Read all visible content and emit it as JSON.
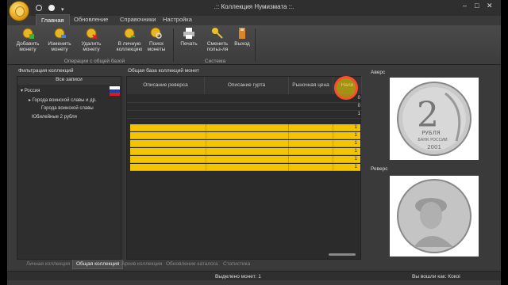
{
  "window": {
    "title": ".:: Коллекция Нумизмата ::."
  },
  "ribbon_tabs": [
    {
      "label": "Главная",
      "active": true
    },
    {
      "label": "Обновление",
      "active": false
    },
    {
      "label": "Справочники",
      "active": false
    },
    {
      "label": "Настройка",
      "active": false
    }
  ],
  "ribbon": {
    "buttons": [
      {
        "label": "Добавить монету",
        "icon": "add-coin-icon"
      },
      {
        "label": "Изменить монету",
        "icon": "edit-coin-icon"
      },
      {
        "label": "Удалить монету",
        "icon": "delete-coin-icon"
      },
      {
        "label": "В личную коллекцию",
        "icon": "personal-collection-icon"
      },
      {
        "label": "Поиск монеты",
        "icon": "search-coin-icon"
      },
      {
        "label": "Печать",
        "icon": "printer-icon"
      },
      {
        "label": "Сменить польз-ля",
        "icon": "key-icon"
      },
      {
        "label": "Выход",
        "icon": "exit-icon"
      }
    ],
    "groups": [
      "Операции с общей базой",
      "Система"
    ]
  },
  "filter_pane": {
    "header": "Фильтрация коллекций",
    "all_records": "Все записи",
    "tree": [
      "Россия",
      "Города воинской славы и др.",
      "Города воинской славы",
      "Юбилейные 2 рубля"
    ]
  },
  "grid": {
    "header": "Общая база коллекций монет",
    "columns": [
      "Описание реверса",
      "Описание гурта",
      "Рыночная цена",
      "Нали"
    ],
    "empty_rows": [
      "0",
      "0",
      "1"
    ],
    "yellow_rows": [
      "1",
      "1",
      "1",
      "1",
      "1",
      "1"
    ]
  },
  "preview": {
    "avers_label": "Аверс",
    "revers_label": "Реверс"
  },
  "coin": {
    "denomination": "2",
    "text": "РУБЛЯ",
    "mint": "БАНК РОССИИ",
    "year": "2001"
  },
  "bottom_tabs": [
    {
      "label": "Личная коллекция",
      "active": false
    },
    {
      "label": "Общая коллекция",
      "active": true
    },
    {
      "label": "Архив коллекции",
      "active": false
    },
    {
      "label": "Обновление каталога",
      "active": false
    },
    {
      "label": "Статистика",
      "active": false
    }
  ],
  "status": {
    "selected": "Выделено монет: 1",
    "user": "Вы вошли как: Кокоi"
  },
  "colors": {
    "accent": "#f5c400",
    "highlight": "#ff4d2a"
  }
}
